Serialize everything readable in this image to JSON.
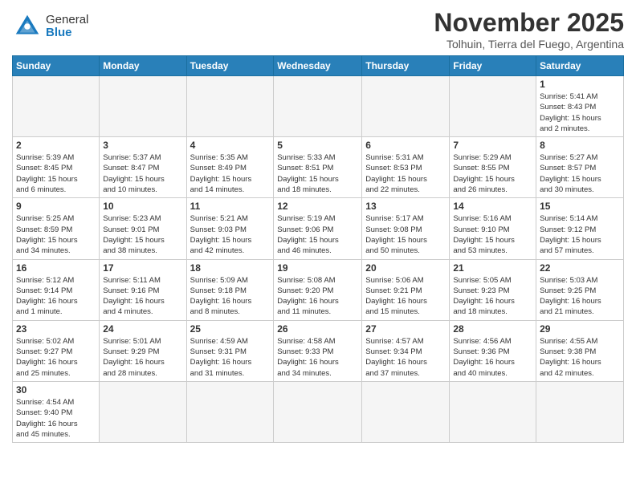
{
  "header": {
    "logo_general": "General",
    "logo_blue": "Blue",
    "month_title": "November 2025",
    "subtitle": "Tolhuin, Tierra del Fuego, Argentina"
  },
  "weekdays": [
    "Sunday",
    "Monday",
    "Tuesday",
    "Wednesday",
    "Thursday",
    "Friday",
    "Saturday"
  ],
  "weeks": [
    [
      {
        "day": "",
        "info": ""
      },
      {
        "day": "",
        "info": ""
      },
      {
        "day": "",
        "info": ""
      },
      {
        "day": "",
        "info": ""
      },
      {
        "day": "",
        "info": ""
      },
      {
        "day": "",
        "info": ""
      },
      {
        "day": "1",
        "info": "Sunrise: 5:41 AM\nSunset: 8:43 PM\nDaylight: 15 hours\nand 2 minutes."
      }
    ],
    [
      {
        "day": "2",
        "info": "Sunrise: 5:39 AM\nSunset: 8:45 PM\nDaylight: 15 hours\nand 6 minutes."
      },
      {
        "day": "3",
        "info": "Sunrise: 5:37 AM\nSunset: 8:47 PM\nDaylight: 15 hours\nand 10 minutes."
      },
      {
        "day": "4",
        "info": "Sunrise: 5:35 AM\nSunset: 8:49 PM\nDaylight: 15 hours\nand 14 minutes."
      },
      {
        "day": "5",
        "info": "Sunrise: 5:33 AM\nSunset: 8:51 PM\nDaylight: 15 hours\nand 18 minutes."
      },
      {
        "day": "6",
        "info": "Sunrise: 5:31 AM\nSunset: 8:53 PM\nDaylight: 15 hours\nand 22 minutes."
      },
      {
        "day": "7",
        "info": "Sunrise: 5:29 AM\nSunset: 8:55 PM\nDaylight: 15 hours\nand 26 minutes."
      },
      {
        "day": "8",
        "info": "Sunrise: 5:27 AM\nSunset: 8:57 PM\nDaylight: 15 hours\nand 30 minutes."
      }
    ],
    [
      {
        "day": "9",
        "info": "Sunrise: 5:25 AM\nSunset: 8:59 PM\nDaylight: 15 hours\nand 34 minutes."
      },
      {
        "day": "10",
        "info": "Sunrise: 5:23 AM\nSunset: 9:01 PM\nDaylight: 15 hours\nand 38 minutes."
      },
      {
        "day": "11",
        "info": "Sunrise: 5:21 AM\nSunset: 9:03 PM\nDaylight: 15 hours\nand 42 minutes."
      },
      {
        "day": "12",
        "info": "Sunrise: 5:19 AM\nSunset: 9:06 PM\nDaylight: 15 hours\nand 46 minutes."
      },
      {
        "day": "13",
        "info": "Sunrise: 5:17 AM\nSunset: 9:08 PM\nDaylight: 15 hours\nand 50 minutes."
      },
      {
        "day": "14",
        "info": "Sunrise: 5:16 AM\nSunset: 9:10 PM\nDaylight: 15 hours\nand 53 minutes."
      },
      {
        "day": "15",
        "info": "Sunrise: 5:14 AM\nSunset: 9:12 PM\nDaylight: 15 hours\nand 57 minutes."
      }
    ],
    [
      {
        "day": "16",
        "info": "Sunrise: 5:12 AM\nSunset: 9:14 PM\nDaylight: 16 hours\nand 1 minute."
      },
      {
        "day": "17",
        "info": "Sunrise: 5:11 AM\nSunset: 9:16 PM\nDaylight: 16 hours\nand 4 minutes."
      },
      {
        "day": "18",
        "info": "Sunrise: 5:09 AM\nSunset: 9:18 PM\nDaylight: 16 hours\nand 8 minutes."
      },
      {
        "day": "19",
        "info": "Sunrise: 5:08 AM\nSunset: 9:20 PM\nDaylight: 16 hours\nand 11 minutes."
      },
      {
        "day": "20",
        "info": "Sunrise: 5:06 AM\nSunset: 9:21 PM\nDaylight: 16 hours\nand 15 minutes."
      },
      {
        "day": "21",
        "info": "Sunrise: 5:05 AM\nSunset: 9:23 PM\nDaylight: 16 hours\nand 18 minutes."
      },
      {
        "day": "22",
        "info": "Sunrise: 5:03 AM\nSunset: 9:25 PM\nDaylight: 16 hours\nand 21 minutes."
      }
    ],
    [
      {
        "day": "23",
        "info": "Sunrise: 5:02 AM\nSunset: 9:27 PM\nDaylight: 16 hours\nand 25 minutes."
      },
      {
        "day": "24",
        "info": "Sunrise: 5:01 AM\nSunset: 9:29 PM\nDaylight: 16 hours\nand 28 minutes."
      },
      {
        "day": "25",
        "info": "Sunrise: 4:59 AM\nSunset: 9:31 PM\nDaylight: 16 hours\nand 31 minutes."
      },
      {
        "day": "26",
        "info": "Sunrise: 4:58 AM\nSunset: 9:33 PM\nDaylight: 16 hours\nand 34 minutes."
      },
      {
        "day": "27",
        "info": "Sunrise: 4:57 AM\nSunset: 9:34 PM\nDaylight: 16 hours\nand 37 minutes."
      },
      {
        "day": "28",
        "info": "Sunrise: 4:56 AM\nSunset: 9:36 PM\nDaylight: 16 hours\nand 40 minutes."
      },
      {
        "day": "29",
        "info": "Sunrise: 4:55 AM\nSunset: 9:38 PM\nDaylight: 16 hours\nand 42 minutes."
      }
    ],
    [
      {
        "day": "30",
        "info": "Sunrise: 4:54 AM\nSunset: 9:40 PM\nDaylight: 16 hours\nand 45 minutes."
      },
      {
        "day": "",
        "info": ""
      },
      {
        "day": "",
        "info": ""
      },
      {
        "day": "",
        "info": ""
      },
      {
        "day": "",
        "info": ""
      },
      {
        "day": "",
        "info": ""
      },
      {
        "day": "",
        "info": ""
      }
    ]
  ]
}
